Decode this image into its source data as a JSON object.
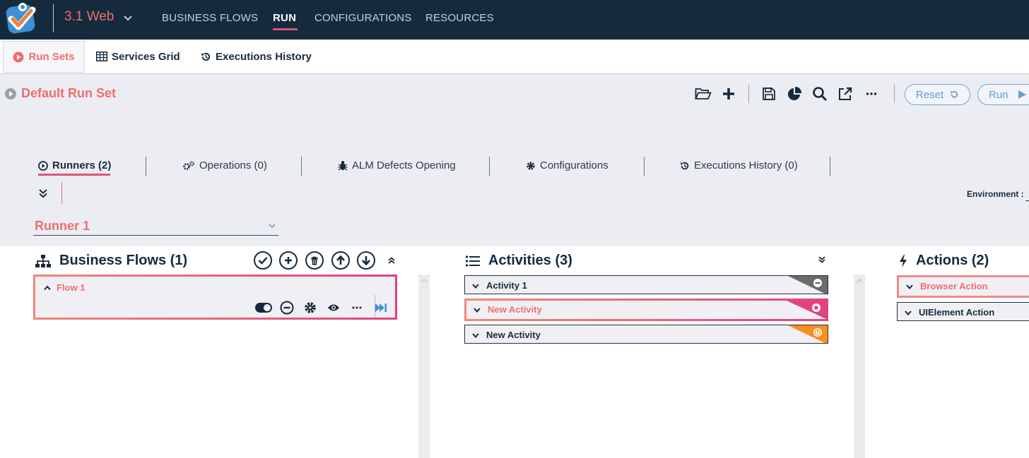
{
  "app": {
    "project": "3.1 Web",
    "nav": [
      "BUSINESS FLOWS",
      "RUN",
      "CONFIGURATIONS",
      "RESOURCES"
    ],
    "active_nav": "RUN"
  },
  "tabs": {
    "run_sets": "Run Sets",
    "services_grid": "Services Grid",
    "executions_history": "Executions History"
  },
  "runset": {
    "title": "Default Run Set",
    "reset_label": "Reset",
    "run_label": "Run"
  },
  "runset_tabs": {
    "runners": "Runners (2)",
    "operations": "Operations (0)",
    "alm": "ALM Defects Opening",
    "configurations": "Configurations",
    "history": "Executions History (0)"
  },
  "environment_label": "Environment :",
  "runner": {
    "name": "Runner 1"
  },
  "business_flows": {
    "title": "Business Flows (1)",
    "items": [
      {
        "name": "Flow 1"
      }
    ]
  },
  "activities": {
    "title": "Activities (3)",
    "items": [
      {
        "name": "Activity 1",
        "status": "skipped",
        "color": "#6b6b6b"
      },
      {
        "name": "New Activity",
        "status": "stopped",
        "color": "#e0437f"
      },
      {
        "name": "New Activity",
        "status": "pending",
        "color": "#f7901e"
      }
    ]
  },
  "actions": {
    "title": "Actions (2)",
    "items": [
      {
        "name": "Browser Action"
      },
      {
        "name": "UIElement Action"
      }
    ]
  },
  "colors": {
    "topbar": "#152b3d",
    "accent": "#ee6e6e",
    "pink": "#e0437f",
    "link_blue": "#5da0d8"
  }
}
